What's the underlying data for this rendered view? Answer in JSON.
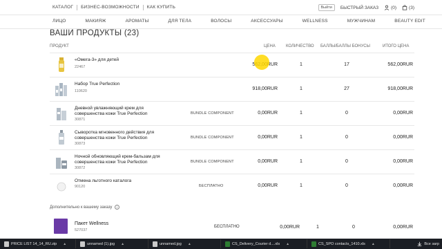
{
  "topnav": {
    "items": [
      "КАТАЛОГ",
      "БИЗНЕС-ВОЗМОЖНОСТИ",
      "КАК КУПИТЬ"
    ],
    "currency": "Выйти",
    "quick_order": "БЫСТРЫЙ ЗАКАЗ",
    "wishlist_count": "(0)",
    "cart_count": "(3)"
  },
  "categories": [
    "ЛИЦО",
    "МАКИЯЖ",
    "АРОМАТЫ",
    "ДЛЯ ТЕЛА",
    "ВОЛОСЫ",
    "АКСЕССУАРЫ",
    "WELLNESS",
    "МУЖЧИНАМ",
    "BEAUTY EDIT"
  ],
  "page_title": "ВАШИ ПРОДУКТЫ (23)",
  "table_headers": {
    "product": "ПРОДУКТ",
    "price": "ЦЕНА",
    "qty": "КОЛИЧЕСТВО",
    "points": "БАЛЛЫ/БАЛЛЫ БОНУСЫ",
    "total": "ИТОГО ЦЕНА"
  },
  "rows": [
    {
      "name": "«Омега-3» для детей",
      "code": "22467",
      "tag": "",
      "price": "562,00RUR",
      "qty": "1",
      "points": "17",
      "total": "562,00RUR"
    },
    {
      "name": "Набор True Perfection",
      "code": "110620",
      "tag": "",
      "price": "918,00RUR",
      "qty": "1",
      "points": "27",
      "total": "918,00RUR"
    },
    {
      "name": "Дневной увлажняющий крем для совершенства кожи True Perfection",
      "code": "30871",
      "tag": "BUNDLE COMPONENT",
      "price": "0,00RUR",
      "qty": "1",
      "points": "0",
      "total": "0,00RUR"
    },
    {
      "name": "Сыворотка мгновенного действия для совершенства кожи True Perfection",
      "code": "30873",
      "tag": "BUNDLE COMPONENT",
      "price": "0,00RUR",
      "qty": "1",
      "points": "0",
      "total": "0,00RUR"
    },
    {
      "name": "Ночной обновляющий крем-бальзам для совершенства кожи True Perfection",
      "code": "30872",
      "tag": "BUNDLE COMPONENT",
      "price": "0,00RUR",
      "qty": "1",
      "points": "0",
      "total": "0,00RUR"
    },
    {
      "name": "Отмена льготного каталога",
      "code": "90120",
      "tag": "БЕСПЛАТНО",
      "price": "0,00RUR",
      "qty": "1",
      "points": "0",
      "total": "0,00RUR"
    }
  ],
  "additional_note": "Дополнительно к вашему заказу",
  "extra_item": {
    "name": "Пакет Wellness",
    "code": "527037",
    "tag": "БЕСПЛАТНО",
    "price": "0,00RUR",
    "qty": "1",
    "points": "0",
    "total": "0,00RUR"
  },
  "taskbar": {
    "items": [
      "PRICE LIST 14_14_RU.zip",
      "unnamed (1).jpg",
      "unnamed.jpg",
      "CS_Delivery_Courier d....xls",
      "CS_SPO contacts_1410.xls"
    ],
    "show_all": "Все загр"
  },
  "colors": {
    "accent_highlight": "#ffd700",
    "taskbar": "#1b1e24",
    "wellness_pack": "#6a3aa6"
  }
}
